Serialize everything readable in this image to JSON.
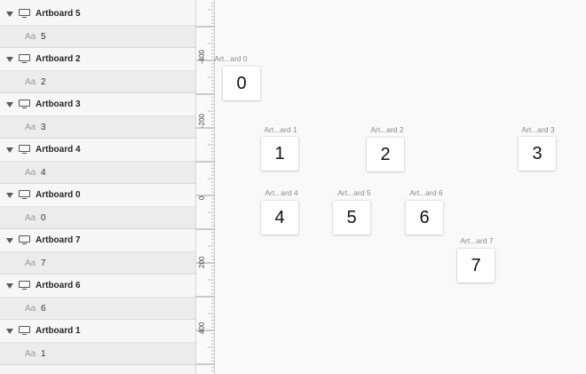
{
  "layers": [
    {
      "artboard": "Artboard 5",
      "text_icon": "Aa",
      "text": "5"
    },
    {
      "artboard": "Artboard 2",
      "text_icon": "Aa",
      "text": "2"
    },
    {
      "artboard": "Artboard 3",
      "text_icon": "Aa",
      "text": "3"
    },
    {
      "artboard": "Artboard 4",
      "text_icon": "Aa",
      "text": "4"
    },
    {
      "artboard": "Artboard 0",
      "text_icon": "Aa",
      "text": "0"
    },
    {
      "artboard": "Artboard 7",
      "text_icon": "Aa",
      "text": "7"
    },
    {
      "artboard": "Artboard 6",
      "text_icon": "Aa",
      "text": "6"
    },
    {
      "artboard": "Artboard 1",
      "text_icon": "Aa",
      "text": "1"
    }
  ],
  "ruler": {
    "labels": [
      "-400",
      "-200",
      "0",
      "200",
      "400"
    ]
  },
  "canvas": {
    "artboards": [
      {
        "name": "Art...ard 0",
        "content": "0"
      },
      {
        "name": "Art...ard 1",
        "content": "1"
      },
      {
        "name": "Art...ard 2",
        "content": "2"
      },
      {
        "name": "Art...ard 3",
        "content": "3"
      },
      {
        "name": "Art...ard 4",
        "content": "4"
      },
      {
        "name": "Art...ard 5",
        "content": "5"
      },
      {
        "name": "Art...ard 6",
        "content": "6"
      },
      {
        "name": "Art...ard 7",
        "content": "7"
      }
    ]
  }
}
